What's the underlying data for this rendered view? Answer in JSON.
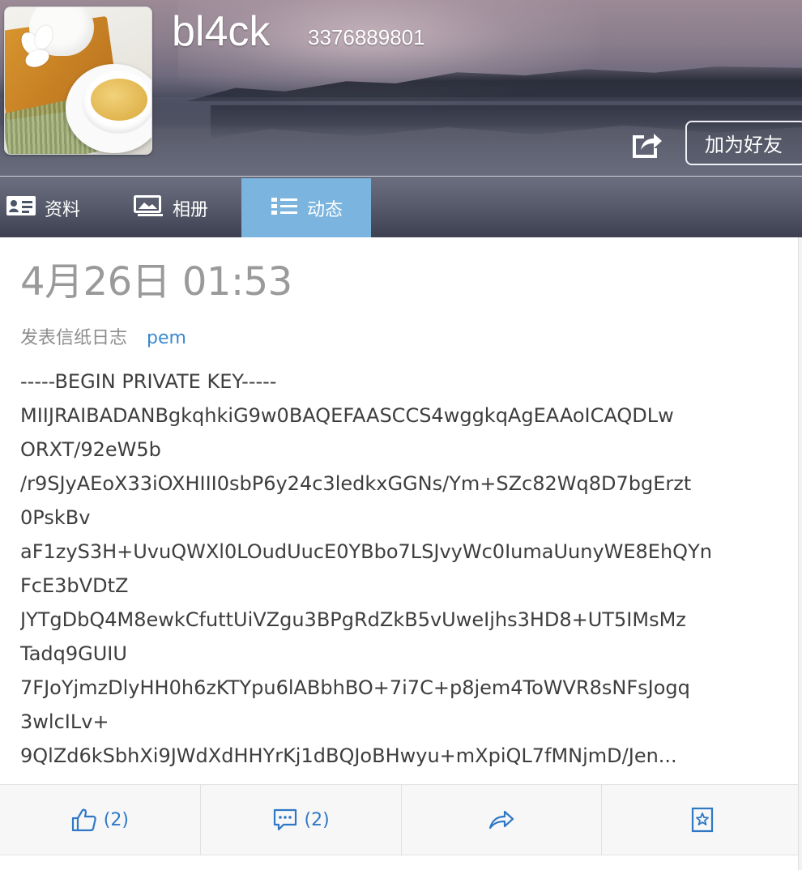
{
  "profile": {
    "username": "bl4ck",
    "qq_number": "3376889801",
    "add_friend_label": "加为好友"
  },
  "tabs": [
    {
      "label": "资料",
      "icon": "id-card-icon"
    },
    {
      "label": "相册",
      "icon": "photo-album-icon"
    },
    {
      "label": "动态",
      "icon": "list-icon",
      "active": true
    }
  ],
  "post": {
    "date": "4月26日 01:53",
    "action": "发表信纸日志",
    "title": "pem",
    "lines": [
      "-----BEGIN PRIVATE KEY-----",
      "MIIJRAIBADANBgkqhkiG9w0BAQEFAASCCS4wggkqAgEAAoICAQDLw",
      "ORXT/92eW5b",
      "/r9SJyAEoX33iOXHIII0sbP6y24c3ledkxGGNs/Ym+SZc82Wq8D7bgErzt",
      "0PskBv",
      "aF1zyS3H+UvuQWXl0LOudUucE0YBbo7LSJvyWc0IumaUunyWE8EhQYn",
      "FcE3bVDtZ",
      "JYTgDbQ4M8ewkCfuttUiVZgu3BPgRdZkB5vUweIjhs3HD8+UT5IMsMz",
      "Tadq9GUIU",
      "7FJoYjmzDlyHH0h6zKTYpu6lABbhBO+7i7C+p8jem4ToWVR8sNFsJogq",
      "3wlcILv+",
      "9QlZd6kSbhXi9JWdXdHHYrKj1dBQJoBHwyu+mXpiQL7fMNjmD/Jen..."
    ]
  },
  "actions": {
    "like_count": "(2)",
    "comment_count": "(2)"
  },
  "colors": {
    "accent": "#7ab4df",
    "link": "#3a89cf",
    "action_blue": "#2f78c6",
    "muted": "#9a9a9a"
  }
}
